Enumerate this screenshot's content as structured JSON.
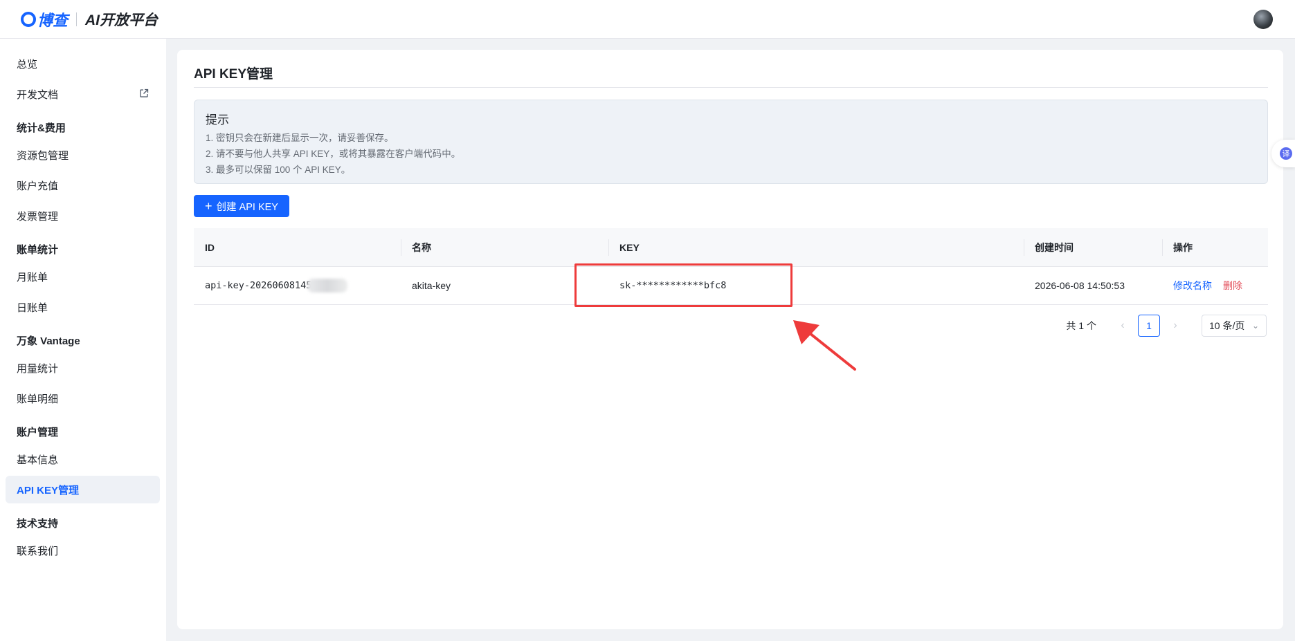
{
  "brand": {
    "logo_text": "博查",
    "title": "AI开放平台"
  },
  "sidebar": {
    "items": [
      {
        "label": "总览"
      },
      {
        "label": "开发文档"
      },
      {
        "label": "资源包管理"
      },
      {
        "label": "账户充值"
      },
      {
        "label": "发票管理"
      },
      {
        "label": "月账单"
      },
      {
        "label": "日账单"
      },
      {
        "label": "用量统计"
      },
      {
        "label": "账单明细"
      },
      {
        "label": "基本信息"
      },
      {
        "label": "API KEY管理"
      },
      {
        "label": "联系我们"
      }
    ],
    "groups": [
      {
        "label": "统计&费用"
      },
      {
        "label": "账单统计"
      },
      {
        "label": "万象 Vantage"
      },
      {
        "label": "账户管理"
      },
      {
        "label": "技术支持"
      }
    ]
  },
  "main": {
    "title": "API KEY管理",
    "notice": {
      "title": "提示",
      "lines": [
        "1. 密钥只会在新建后显示一次，请妥善保存。",
        "2. 请不要与他人共享 API KEY，或将其暴露在客户端代码中。",
        "3. 最多可以保留 100 个 API KEY。"
      ]
    },
    "create_button": "创建 API KEY",
    "table": {
      "headers": [
        "ID",
        "名称",
        "KEY",
        "创建时间",
        "操作"
      ],
      "rows": [
        {
          "id": "api-key-20260608145",
          "name": "akita-key",
          "key": "sk-************bfc8",
          "created": "2026-06-08 14:50:53",
          "action_rename": "修改名称",
          "action_delete": "删除"
        }
      ]
    },
    "pagination": {
      "total": "共 1 个",
      "current_page": "1",
      "page_size": "10 条/页"
    }
  },
  "float_tab": {
    "label": "译"
  },
  "colors": {
    "accent": "#1664ff",
    "danger": "#e34d59",
    "annotation": "#ee3b3b"
  }
}
